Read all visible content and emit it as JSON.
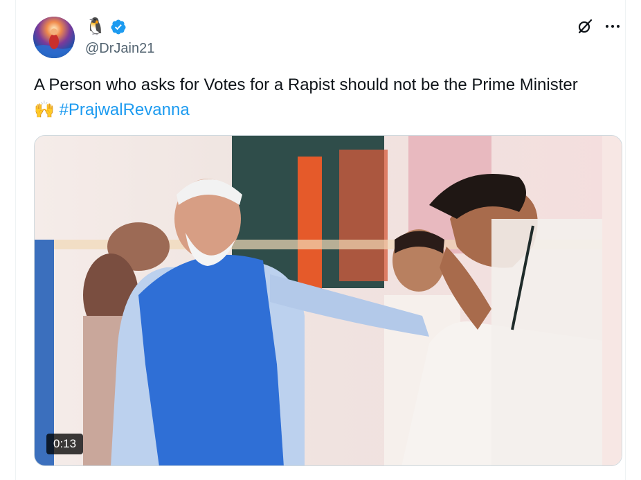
{
  "tweet": {
    "display_name_emoji": "🐧",
    "handle": "@DrJain21",
    "verified": true,
    "text": "A Person who asks for Votes for a Rapist should not be the Prime Minister",
    "emoji": "🙌",
    "hashtag": "#PrajwalRevanna",
    "video_duration": "0:13"
  },
  "icons": {
    "verified": "verified-badge-icon",
    "grok": "grok-icon",
    "more": "more-options-icon"
  },
  "colors": {
    "link": "#1d9bf0",
    "secondary_text": "#536471",
    "verified_badge": "#1d9bf0"
  }
}
